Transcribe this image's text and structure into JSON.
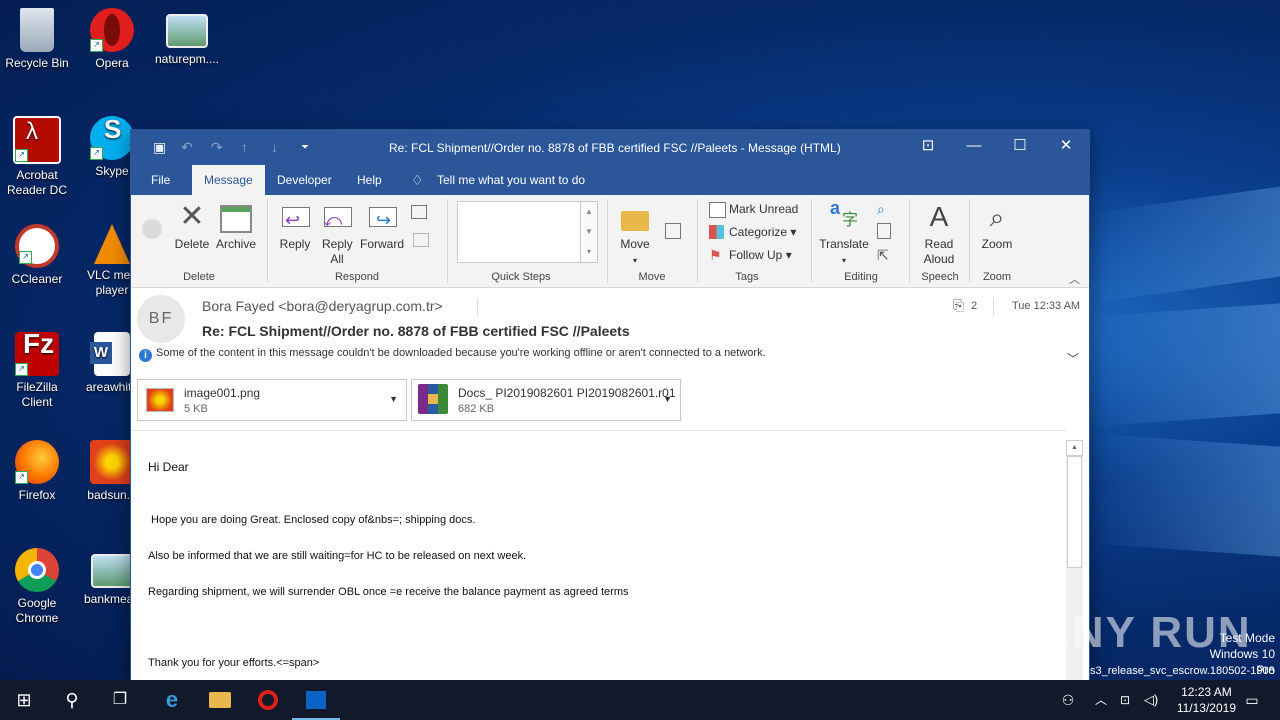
{
  "desktop": {
    "icons": [
      {
        "label": "Recycle Bin",
        "icon": "recycle-bin-icon"
      },
      {
        "label": "Opera",
        "icon": "opera-icon"
      },
      {
        "label": "naturepm....",
        "icon": "image-file-icon"
      },
      {
        "label": "Acrobat Reader DC",
        "icon": "acrobat-icon"
      },
      {
        "label": "Skype",
        "icon": "skype-icon"
      },
      {
        "label": "CCleaner",
        "icon": "ccleaner-icon"
      },
      {
        "label": "VLC med player",
        "icon": "vlc-icon"
      },
      {
        "label": "FileZilla Client",
        "icon": "filezilla-icon"
      },
      {
        "label": "areawhite",
        "icon": "word-doc-icon"
      },
      {
        "label": "Firefox",
        "icon": "firefox-icon"
      },
      {
        "label": "badsun.p",
        "icon": "image-file-icon"
      },
      {
        "label": "Google Chrome",
        "icon": "chrome-icon"
      },
      {
        "label": "bankmean",
        "icon": "image-file-icon"
      }
    ]
  },
  "window": {
    "title": "Re: FCL Shipment//Order no. 8878 of FBB certified FSC //Paleets  -  Message (HTML)",
    "tabs": [
      "File",
      "Message",
      "Developer",
      "Help"
    ],
    "active_tab": "Message",
    "tell_me": "Tell me what you want to do"
  },
  "ribbon": {
    "delete_label": "Delete",
    "archive_label": "Archive",
    "group_delete": "Delete",
    "reply_label": "Reply",
    "reply_all_label": "Reply All",
    "forward_label": "Forward",
    "group_respond": "Respond",
    "group_quick_steps": "Quick Steps",
    "move_label": "Move",
    "group_move": "Move",
    "mark_unread": "Mark Unread",
    "categorize": "Categorize",
    "follow_up": "Follow Up",
    "group_tags": "Tags",
    "translate_label": "Translate",
    "group_editing": "Editing",
    "read_aloud_label": "Read Aloud",
    "group_speech": "Speech",
    "zoom_label": "Zoom",
    "group_zoom": "Zoom"
  },
  "message": {
    "avatar_initials": "BF",
    "from": "Bora Fayed <bora@deryagrup.com.tr>",
    "attachment_count": "2",
    "time": "Tue 12:33 AM",
    "subject": "Re: FCL Shipment//Order no. 8878 of FBB certified FSC //Paleets",
    "info": "Some of the content in this message couldn't be downloaded because you're working offline or aren't connected to a network.",
    "attachments": [
      {
        "name": "image001.png",
        "size": "5 KB"
      },
      {
        "name": "Docs_ PI2019082601 PI2019082601.r01",
        "size": "682 KB"
      }
    ],
    "body": [
      "Hi Dear",
      " Hope you are doing Great. Enclosed copy of&nbs=; shipping docs.",
      "Also be informed that we are still waiting=for HC to be released on next week.",
      "Regarding shipment, we will surrender OBL once =e receive the balance payment as agreed terms",
      "Thank you for your efforts.<=span>"
    ]
  },
  "taskbar": {
    "time": "12:23 AM",
    "date": "11/13/2019"
  },
  "watermark": {
    "line1": "Test Mode",
    "line2": "Windows 10 Pro",
    "line3": "s3_release_svc_escrow.180502-1908",
    "brand": "ANY RUN"
  }
}
